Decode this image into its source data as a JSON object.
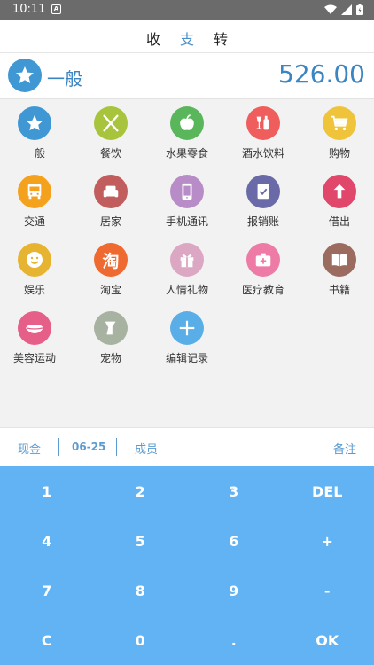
{
  "status": {
    "time": "10:11",
    "notif_glyph": "A"
  },
  "tabs": [
    {
      "label": "收",
      "active": false
    },
    {
      "label": "支",
      "active": true
    },
    {
      "label": "转",
      "active": false
    }
  ],
  "current_category": {
    "name": "一般",
    "icon": "star-icon",
    "amount": "526.00"
  },
  "categories": [
    {
      "label": "一般",
      "icon": "star-icon",
      "color": "#3f97d4"
    },
    {
      "label": "餐饮",
      "icon": "fork-knife-icon",
      "color": "#a8c43c"
    },
    {
      "label": "水果零食",
      "icon": "apple-icon",
      "color": "#5ab65a"
    },
    {
      "label": "酒水饮料",
      "icon": "wine-icon",
      "color": "#ef5d5d"
    },
    {
      "label": "购物",
      "icon": "cart-icon",
      "color": "#f0c43a"
    },
    {
      "label": "交通",
      "icon": "bus-icon",
      "color": "#f4a21e"
    },
    {
      "label": "居家",
      "icon": "sofa-icon",
      "color": "#c25d5d"
    },
    {
      "label": "手机通讯",
      "icon": "phone-icon",
      "color": "#b88dc7"
    },
    {
      "label": "报销账",
      "icon": "check-doc-icon",
      "color": "#6a6aa8"
    },
    {
      "label": "借出",
      "icon": "arrow-up-icon",
      "color": "#e0476a"
    },
    {
      "label": "娱乐",
      "icon": "smile-icon",
      "color": "#e6b430"
    },
    {
      "label": "淘宝",
      "icon": "taobao-icon",
      "color": "#ee6a30",
      "glyph": "淘"
    },
    {
      "label": "人情礼物",
      "icon": "gift-icon",
      "color": "#dba7c2"
    },
    {
      "label": "医疗教育",
      "icon": "medkit-icon",
      "color": "#ee7ba6"
    },
    {
      "label": "书籍",
      "icon": "book-icon",
      "color": "#9c6b60"
    },
    {
      "label": "美容运动",
      "icon": "lips-icon",
      "color": "#e65f88"
    },
    {
      "label": "宠物",
      "icon": "pet-icon",
      "color": "#a7b2a0"
    },
    {
      "label": "编辑记录",
      "icon": "plus-icon",
      "color": "#5aaee8"
    }
  ],
  "info": {
    "account": "现金",
    "date": "06-25",
    "member": "成员",
    "note": "备注"
  },
  "keypad": [
    [
      "1",
      "2",
      "3",
      "DEL"
    ],
    [
      "4",
      "5",
      "6",
      "+"
    ],
    [
      "7",
      "8",
      "9",
      "-"
    ],
    [
      "C",
      "0",
      ".",
      "OK"
    ]
  ]
}
